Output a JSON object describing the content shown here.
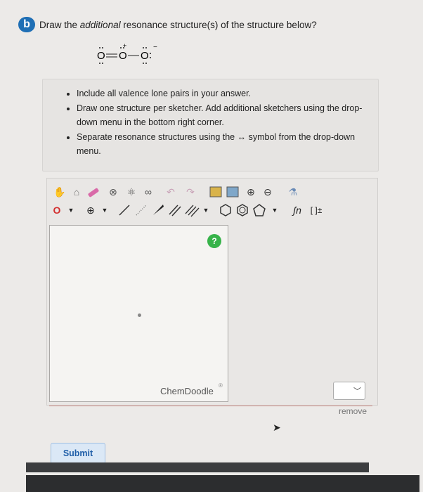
{
  "question": {
    "badge": "b",
    "prefix": "Draw the ",
    "emphasis": "additional",
    "suffix": " resonance structure(s) of the structure below?"
  },
  "molecule": {
    "atoms": [
      "O",
      "O",
      "O"
    ],
    "charges": [
      "",
      "+",
      "−"
    ]
  },
  "instructions": [
    "Include all valence lone pairs in your answer.",
    "Draw one structure per sketcher. Add additional sketchers using the drop-down menu in the bottom right corner.",
    "Separate resonance structures using the ↔ symbol from the drop-down menu."
  ],
  "toolbar": {
    "atom_label": "O",
    "charge_label": "⊕",
    "sn_label": "ʃn",
    "bracket_label": "[ ]±"
  },
  "sketcher": {
    "help_label": "?",
    "brand": "ChemDoodle",
    "brand_mark": "®"
  },
  "remove_label": "remove",
  "submit_label": "Submit",
  "colors": {
    "accent": "#1f6fb5",
    "help": "#37b34a"
  }
}
